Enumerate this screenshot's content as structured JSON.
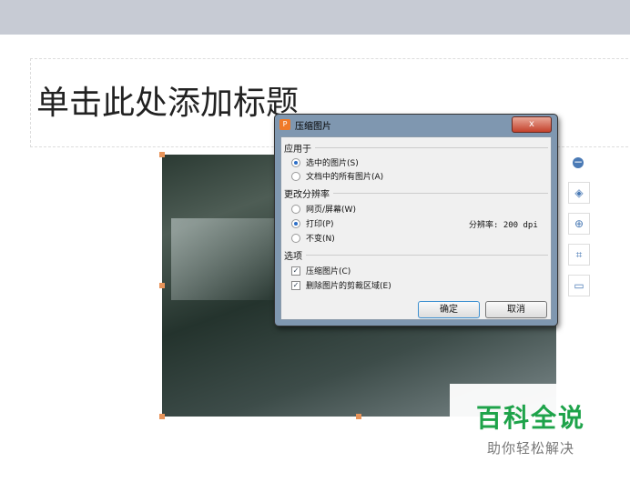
{
  "slide": {
    "title_placeholder": "单击此处添加标题"
  },
  "dialog": {
    "title": "压缩图片",
    "close_label": "x",
    "apply_to": {
      "label": "应用于",
      "options": [
        "选中的图片(S)",
        "文档中的所有图片(A)"
      ],
      "selected": 0
    },
    "resolution": {
      "label": "更改分辨率",
      "options": [
        "网页/屏幕(W)",
        "打印(P)",
        "不变(N)"
      ],
      "selected": 1,
      "readout": "分辨率: 200 dpi"
    },
    "options": {
      "label": "选项",
      "items": [
        {
          "label": "压缩图片(C)",
          "checked": true
        },
        {
          "label": "删除图片的剪裁区域(E)",
          "checked": true
        }
      ]
    },
    "ok": "确定",
    "cancel": "取消"
  },
  "watermark": {
    "line1": "百科全说",
    "line2": "助你轻松解决"
  }
}
